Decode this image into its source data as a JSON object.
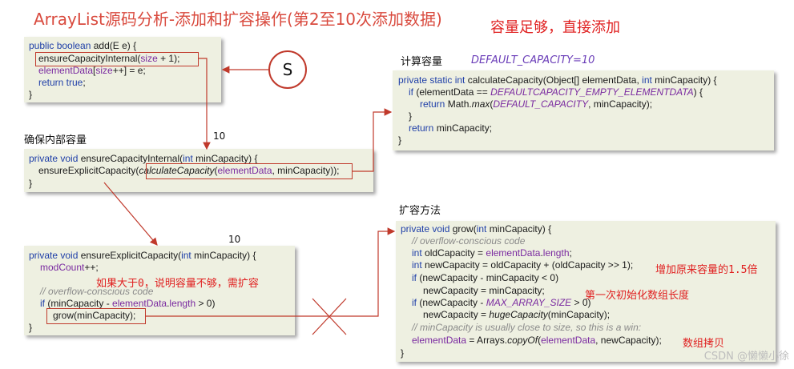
{
  "title": "ArrayList源码分析-添加和扩容操作(第2至10次添加数据)",
  "note_enough": "容量足够，直接添加",
  "labels": {
    "ensure_internal": "确保内部容量",
    "calculate": "计算容量",
    "grow": "扩容方法",
    "default_capacity": "DEFAULT_CAPACITY=10",
    "num_a": "10",
    "num_b": "10",
    "s": "S"
  },
  "annotations": {
    "need_expand": "如果大于0，说明容量不够，需扩容",
    "grow_1_5": "增加原来容量的1.5倍",
    "first_init": "第一次初始化数组长度",
    "copy": "数组拷贝"
  },
  "add": {
    "l1a": "public boolean",
    "l1b": " add(E e) {",
    "l2a": "ensureCapacityInternal(",
    "l2b": "size",
    "l2c": " + 1);",
    "l3a": "elementData",
    "l3b": "[",
    "l3c": "size",
    "l3d": "++] = e;",
    "l4a": "return true",
    "l4b": ";",
    "l5": "}"
  },
  "ensure_internal": {
    "l1a": "private void",
    "l1b": " ensureCapacityInternal(",
    "l1c": "int",
    "l1d": " minCapacity) {",
    "l2a": "ensureExplicitCapacity(",
    "l2b": "calculateCapacity",
    "l2c": "(",
    "l2d": "elementData",
    "l2e": ", minCapacity));",
    "l3": "}"
  },
  "calculate": {
    "l1a": "private static int",
    "l1b": " calculateCapacity(Object[] elementData, ",
    "l1c": "int",
    "l1d": " minCapacity) {",
    "l2a": "if",
    "l2b": " (elementData == ",
    "l2c": "DEFAULTCAPACITY_EMPTY_ELEMENTDATA",
    "l2d": ") {",
    "l3a": "return",
    "l3b": " Math.",
    "l3c": "max",
    "l3d": "(",
    "l3e": "DEFAULT_CAPACITY",
    "l3f": ", minCapacity);",
    "l4": "}",
    "l5a": "return",
    "l5b": " minCapacity;",
    "l6": "}"
  },
  "ensure_explicit": {
    "l1a": "private void",
    "l1b": " ensureExplicitCapacity(",
    "l1c": "int",
    "l1d": " minCapacity) {",
    "l2a": "modCount",
    "l2b": "++;",
    "l3": "// overflow-conscious code",
    "l4a": "if",
    "l4b": " (minCapacity - ",
    "l4c": "elementData",
    "l4d": ".",
    "l4e": "length",
    "l4f": " > 0)",
    "l5": "grow(minCapacity);",
    "l6": "}"
  },
  "grow": {
    "l1a": "private void",
    "l1b": " grow(",
    "l1c": "int",
    "l1d": " minCapacity) {",
    "l2": "// overflow-conscious code",
    "l3a": "int",
    "l3b": " oldCapacity = ",
    "l3c": "elementData",
    "l3d": ".",
    "l3e": "length",
    "l3f": ";",
    "l4a": "int",
    "l4b": " newCapacity = oldCapacity + (oldCapacity >> 1);",
    "l5a": "if",
    "l5b": " (newCapacity - minCapacity < 0)",
    "l6": "newCapacity = minCapacity;",
    "l7a": "if",
    "l7b": " (newCapacity - ",
    "l7c": "MAX_ARRAY_SIZE",
    "l7d": " > 0)",
    "l8a": "newCapacity = ",
    "l8b": "hugeCapacity",
    "l8c": "(minCapacity);",
    "l9": "// minCapacity is usually close to size, so this is a win:",
    "l10a": "elementData",
    "l10b": " = Arrays.",
    "l10c": "copyOf",
    "l10d": "(",
    "l10e": "elementData",
    "l10f": ", newCapacity);",
    "l11": "}"
  },
  "watermark": "CSDN @懒懒小徐",
  "colors": {
    "title": "#d94a3e",
    "arrow": "#c0392b",
    "code_bg": "#eef0e1",
    "keyword": "#1f3fa8",
    "field": "#7a2aa0"
  }
}
